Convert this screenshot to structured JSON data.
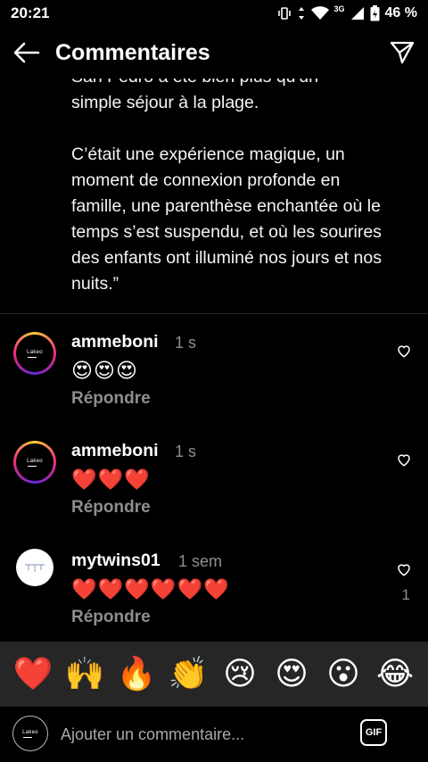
{
  "status_bar": {
    "time": "20:21",
    "network": "3G",
    "battery": "46 %"
  },
  "header": {
    "title": "Commentaires",
    "back_icon": "arrow-left-icon",
    "share_icon": "send-icon"
  },
  "caption": {
    "text": "San Pedro a été bien plus qu'un\nsimple séjour à la plage.\n\nC’était une expérience magique, un moment de connexion profonde en famille, une parenthèse enchantée où le temps s’est suspendu, et où les sourires des enfants ont illuminé nos jours et nos nuits.”"
  },
  "comments": [
    {
      "username": "ammeboni",
      "time": "1 s",
      "text": "😍😍😍",
      "reply": "Répondre",
      "avatar_text": "Lakeo"
    },
    {
      "username": "ammeboni",
      "time": "1 s",
      "text": "❤️❤️❤️",
      "reply": "Répondre",
      "avatar_text": "Lakeo"
    },
    {
      "username": "mytwins01",
      "time": "1 sem",
      "text": "❤️❤️❤️❤️❤️❤️",
      "reply": "Répondre",
      "likes": "1"
    }
  ],
  "reactions": [
    "❤️",
    "🙌",
    "🔥",
    "👏",
    "😢",
    "😍",
    "😮",
    "😂"
  ],
  "input": {
    "placeholder": "Ajouter un commentaire...",
    "gif_label": "GIF",
    "avatar_text": "Lakeo"
  },
  "colors": {
    "background": "#000000",
    "muted": "#8e8e8e",
    "reaction_bar": "#262626"
  }
}
